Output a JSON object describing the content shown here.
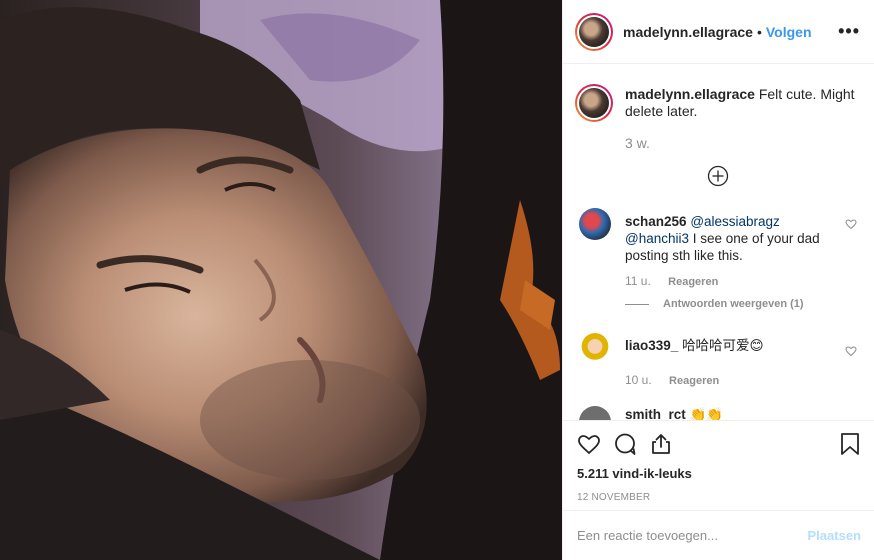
{
  "post": {
    "username": "madelynn.ellagrace",
    "separator": "•",
    "follow_label": "Volgen",
    "more_label": "•••"
  },
  "caption": {
    "username": "madelynn.ellagrace",
    "text": "Felt cute. Might delete later.",
    "time": "3 w."
  },
  "comments": [
    {
      "username": "schan256",
      "mention1": "@alessiabragz",
      "mention2": "@hanchii3",
      "text": "I see one of your dad posting sth like this.",
      "time": "11 u.",
      "reply_label": "Reageren",
      "view_replies": "Antwoorden weergeven (1)"
    },
    {
      "username": "liao339_",
      "text": "哈哈哈可爱😊",
      "time": "10 u.",
      "reply_label": "Reageren"
    },
    {
      "username": "smith_rct",
      "text": "👏👏"
    }
  ],
  "actions": {
    "likes": "5.211 vind-ik-leuks",
    "date": "12 NOVEMBER"
  },
  "add_comment": {
    "placeholder": "Een reactie toevoegen...",
    "post_label": "Plaatsen"
  },
  "colors": {
    "link": "#3897f0",
    "mention": "#003569",
    "muted": "#8e8e8e",
    "text": "#262626",
    "post_disabled": "#b2dffc"
  },
  "icons": [
    "more-icon",
    "add-circle-icon",
    "heart-icon",
    "comment-icon",
    "share-icon",
    "bookmark-icon"
  ]
}
